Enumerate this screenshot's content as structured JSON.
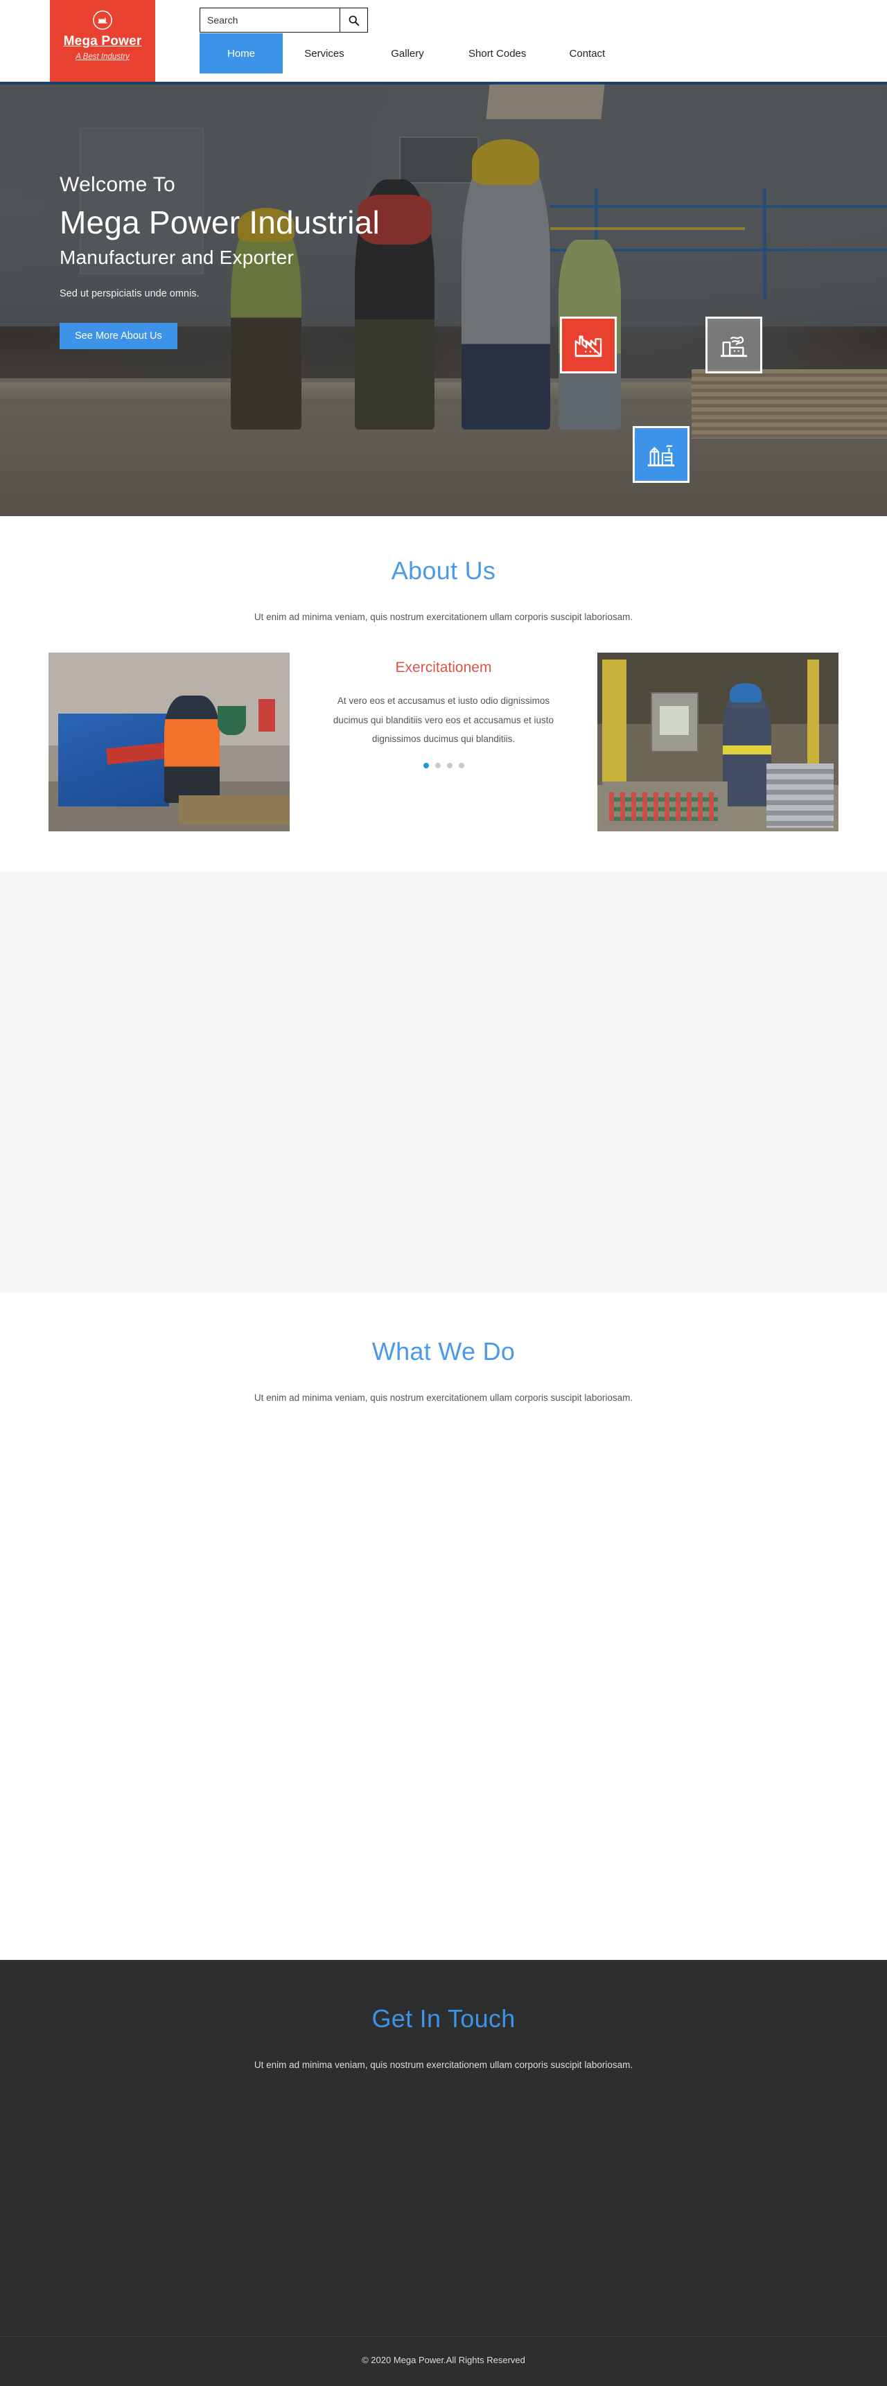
{
  "brand": {
    "logo_icon": "factory-circle-icon",
    "name": "Mega Power",
    "tagline": "A Best Industry"
  },
  "search": {
    "placeholder": "Search",
    "value": "",
    "button_icon": "search-icon"
  },
  "nav": {
    "items": [
      {
        "label": "Home",
        "active": true
      },
      {
        "label": "Services",
        "active": false
      },
      {
        "label": "Gallery",
        "active": false
      },
      {
        "label": "Short Codes",
        "active": false
      },
      {
        "label": "Contact",
        "active": false
      }
    ]
  },
  "hero": {
    "welcome": "Welcome To",
    "title": "Mega Power Industrial",
    "subtitle": "Manufacturer and Exporter",
    "text": "Sed ut perspiciatis unde omnis.",
    "button_label": "See More About Us",
    "icons": [
      {
        "name": "factory-chart-icon",
        "color": "#e8412f"
      },
      {
        "name": "factory-smoke-icon",
        "color": "#8c8c8c"
      },
      {
        "name": "industrial-plant-icon",
        "color": "#3d93e8"
      }
    ]
  },
  "about": {
    "title": "About Us",
    "subtitle": "Ut enim ad minima veniam, quis nostrum exercitationem ullam corporis suscipit laboriosam.",
    "heading": "Exercitationem",
    "body": "At vero eos et accusamus et iusto odio dignissimos ducimus qui blanditiis vero eos et accusamus et iusto dignissimos ducimus qui blanditiis.",
    "dots": [
      {
        "active": true
      },
      {
        "active": false
      },
      {
        "active": false
      },
      {
        "active": false
      }
    ],
    "image_left_alt": "worker-operating-blue-saw-machine",
    "image_right_alt": "worker-at-foundry-control-panel"
  },
  "whatwedo": {
    "title": "What We Do",
    "subtitle": "Ut enim ad minima veniam, quis nostrum exercitationem ullam corporis suscipit laboriosam."
  },
  "contact": {
    "title": "Get In Touch",
    "subtitle": "Ut enim ad minima veniam, quis nostrum exercitationem ullam corporis suscipit laboriosam."
  },
  "footer": {
    "copyright": "© 2020 Mega Power.All Rights Reserved"
  },
  "colors": {
    "brand_red": "#e8412f",
    "accent_blue": "#3d93e8",
    "heading_blue": "#4a9ae8",
    "heading_red": "#d9544a",
    "footer_dark": "#2d2e2e",
    "band_gray": "#f5f6f6"
  }
}
